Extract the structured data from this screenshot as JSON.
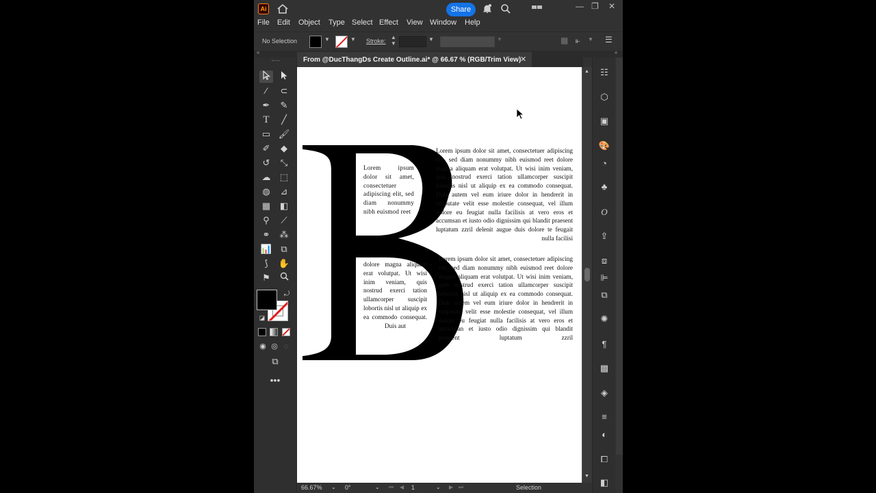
{
  "titlebar": {
    "app_icon": "Ai",
    "home_icon": "home-icon",
    "share_label": "Share",
    "bell_icon": "bell-icon",
    "search_icon": "search-icon",
    "workspace_icon": "workspace-switcher-icon"
  },
  "menu": [
    "File",
    "Edit",
    "Object",
    "Type",
    "Select",
    "Effect",
    "View",
    "Window",
    "Help"
  ],
  "control": {
    "selection_label": "No Selection",
    "stroke_label": "Stroke:"
  },
  "document": {
    "tab_title": "From @DucThangDs Create Outline.ai* @ 66.67 % (RGB/Trim View)",
    "close_label": "✕",
    "big_letter": "B",
    "letter_color": "#000000",
    "inner_top_text": "Lorem ipsum dolor sit amet, consectetuer adipiscing elit, sed diam nonummy nibh euismod reet",
    "inner_bottom_text": "dolore magna aliquam erat volutpat. Ut wisi inim veniam, quis nostrud exerci tation ullamcorper suscipit lobortis nisl ut aliquip ex ea commodo consequat. Duis aut",
    "right_top_text": "Lorem ipsum dolor sit amet, consectetuer adipiscing elit, sed diam nonummy nibh euismod reet dolore magna aliquam erat volutpat. Ut wisi inim veniam, quis nostrud exerci tation ullamcorper suscipit lobortis nisl ut aliquip ex ea commodo consequat. Duis autem vel eum iriure dolor in hendrerit in vulputate velit esse molestie consequat, vel illum dolore eu feugiat nulla facilisis at vero eros et accumsan et iusto odio dignissim qui blandit praesent luptatum zzril delenit augue duis dolore te feugait nulla facilisi",
    "right_bottom_text": "Lorem ipsum dolor sit amet, consectetuer adipiscing elit, sed diam nonummy nibh euismod reet dolore magna aliquam erat volutpat. Ut wisi inim veniam, quis nostrud exerci tation ullamcorper suscipit lobortis nisl ut aliquip ex ea commodo consequat. Duis autem vel eum iriure dolor in hendrerit in vulputate velit esse molestie consequat, vel illum dolore eu feugiat nulla facilisis at vero eros et accumsan et iusto odio dignissim qui blandit praesent luptatum zzril"
  },
  "status": {
    "zoom": "66.67%",
    "rotation": "0°",
    "artboard_number": "1",
    "tool_name": "Selection"
  },
  "colors": {
    "accent": "#1473e6",
    "none_slash": "#e21b1b"
  }
}
